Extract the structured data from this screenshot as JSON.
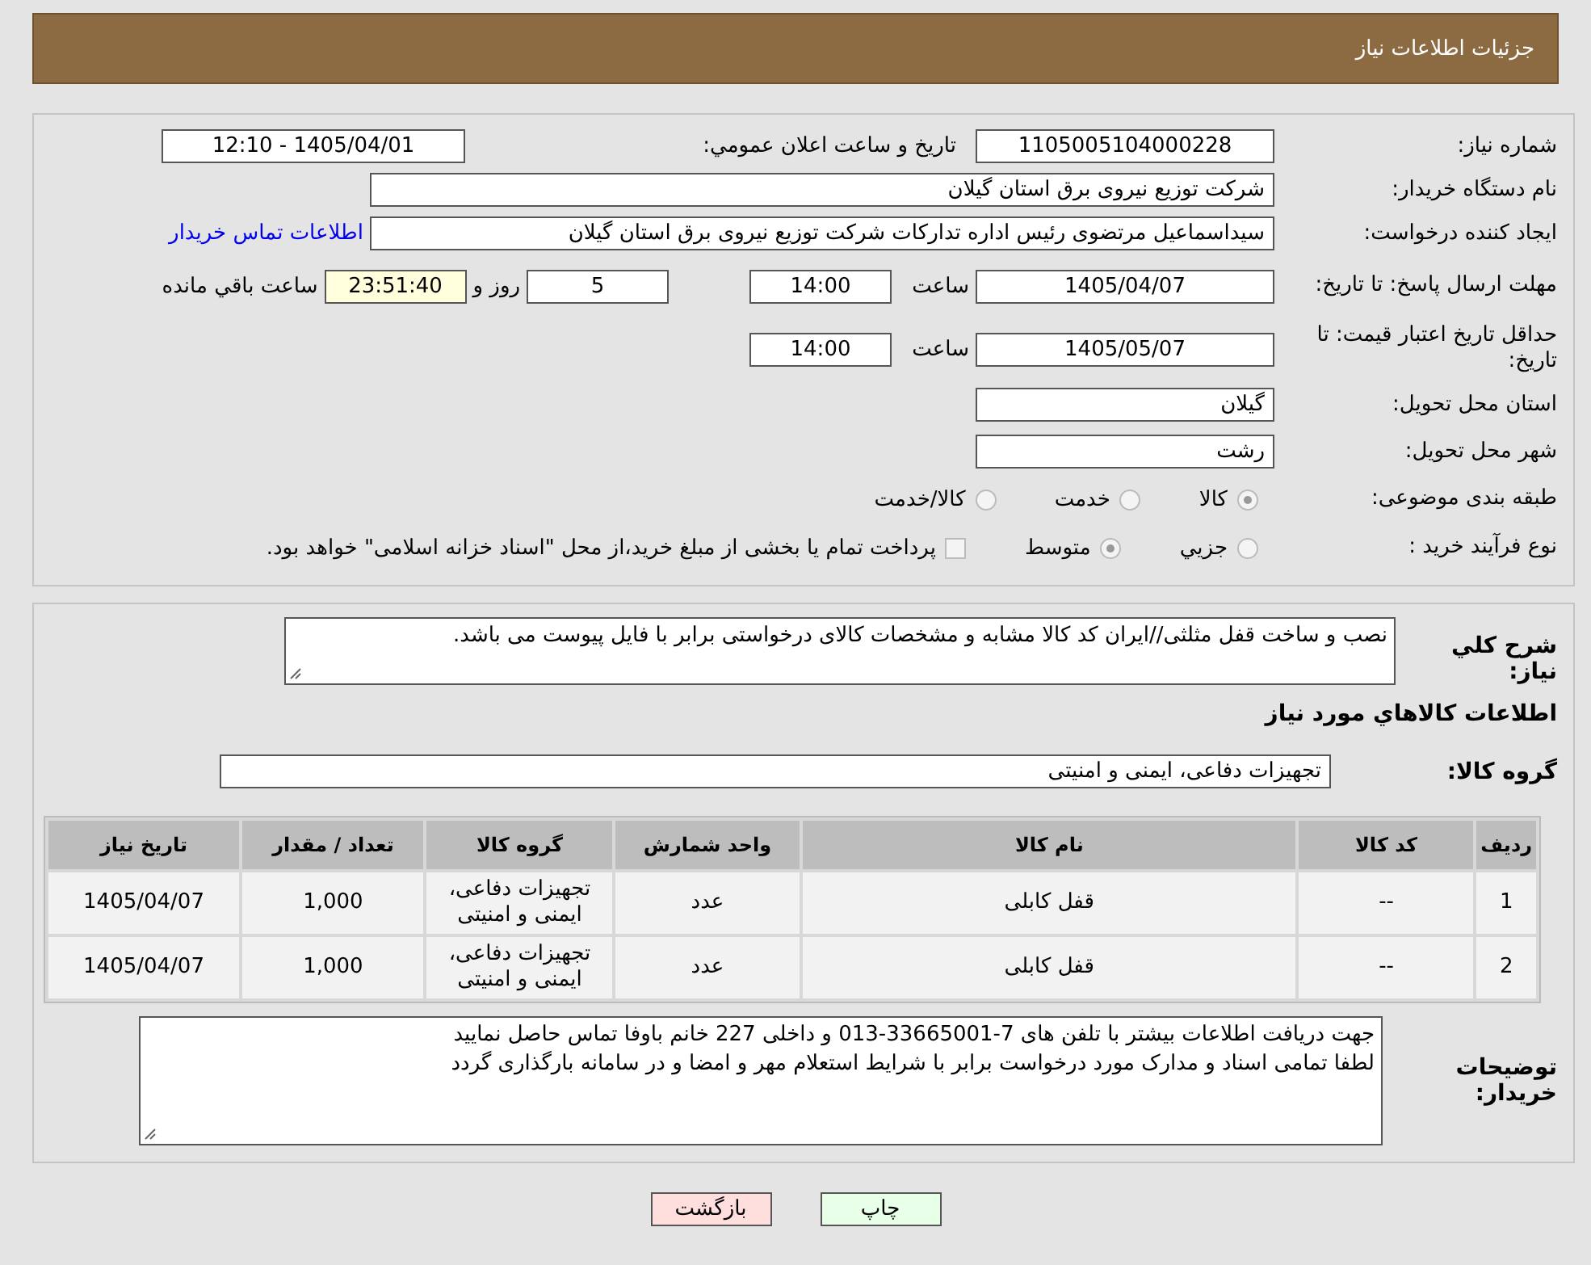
{
  "header": {
    "title": "جزئیات اطلاعات نیاز"
  },
  "need_number": {
    "label": "شماره نیاز:",
    "value": "1105005104000228"
  },
  "announce_date": {
    "label": "تاریخ و ساعت اعلان عمومي:",
    "value": "1405/04/01 - 12:10"
  },
  "buyer_org": {
    "label": "نام دستگاه خریدار:",
    "value": "شرکت توزیع نیروی برق استان گیلان"
  },
  "requester": {
    "label": "ایجاد کننده درخواست:",
    "value": "سیداسماعیل مرتضوی رئیس اداره تدارکات شرکت توزیع نیروی برق استان گیلان",
    "link": "اطلاعات تماس خریدار"
  },
  "response_deadline": {
    "label": "مهلت ارسال پاسخ: تا تاریخ:",
    "date": "1405/04/07",
    "time_label": "ساعت",
    "time": "14:00",
    "days": "5",
    "days_label": "روز و",
    "remaining": "23:51:40",
    "remaining_label": "ساعت باقي مانده"
  },
  "price_validity": {
    "label": "حداقل تاریخ اعتبار قیمت: تا تاریخ:",
    "date": "1405/05/07",
    "time_label": "ساعت",
    "time": "14:00"
  },
  "province": {
    "label": "استان محل تحویل:",
    "value": "گیلان"
  },
  "city": {
    "label": "شهر محل تحویل:",
    "value": "رشت"
  },
  "category": {
    "label": "طبقه بندی موضوعی:",
    "options": [
      {
        "label": "کالا",
        "selected": true
      },
      {
        "label": "خدمت",
        "selected": false
      },
      {
        "label": "کالا/خدمت",
        "selected": false
      }
    ]
  },
  "purchase_type": {
    "label": "نوع فرآیند خرید :",
    "options": [
      {
        "label": "جزيي",
        "selected": false
      },
      {
        "label": "متوسط",
        "selected": true
      }
    ],
    "treasury": {
      "label": "پرداخت تمام یا بخشی از مبلغ خرید،از محل \"اسناد خزانه اسلامی\" خواهد بود.",
      "checked": false
    }
  },
  "summary": {
    "label": "شرح کلي نیاز:",
    "value": "نصب و ساخت قفل مثلثی//ایران کد کالا مشابه و مشخصات کالای درخواستی برابر با فایل پیوست می باشد."
  },
  "goods_heading": "اطلاعات كالاهاي مورد نیاز",
  "goods_group": {
    "label": "گروه کالا:",
    "value": "تجهیزات دفاعی، ایمنی و امنیتی"
  },
  "table": {
    "columns": [
      "ردیف",
      "کد کالا",
      "نام کالا",
      "واحد شمارش",
      "گروه کالا",
      "تعداد / مقدار",
      "تاریخ نیاز"
    ],
    "rows": [
      [
        "1",
        "--",
        "قفل کابلی",
        "عدد",
        "تجهیزات دفاعی، ایمنی و امنیتی",
        "1,000",
        "1405/04/07"
      ],
      [
        "2",
        "--",
        "قفل کابلی",
        "عدد",
        "تجهیزات دفاعی، ایمنی و امنیتی",
        "1,000",
        "1405/04/07"
      ]
    ]
  },
  "buyer_notes": {
    "label": "توضیحات خریدار:",
    "lines": [
      "جهت دریافت اطلاعات بیشتر با تلفن های 7-33665001-013 و داخلی 227 خانم باوفا تماس حاصل نمایید",
      "لطفا تمامی اسناد و مدارک مورد درخواست برابر با شرایط استعلام مهر و امضا و در سامانه بارگذاری گردد"
    ]
  },
  "buttons": [
    {
      "label": "چاپ",
      "kind": "print"
    },
    {
      "label": "بازگشت",
      "kind": "back"
    }
  ]
}
